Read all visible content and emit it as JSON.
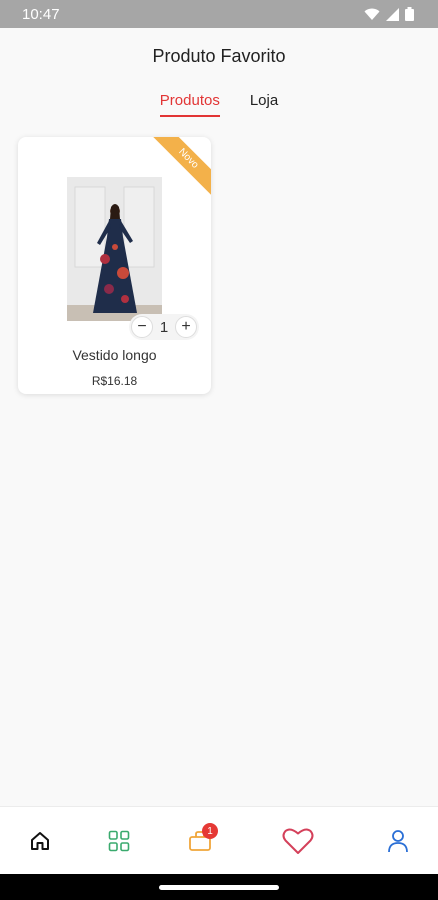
{
  "status_bar": {
    "time": "10:47"
  },
  "header": {
    "title": "Produto Favorito"
  },
  "tabs": [
    {
      "label": "Produtos",
      "active": true
    },
    {
      "label": "Loja",
      "active": false
    }
  ],
  "product": {
    "ribbon": "Novo",
    "name": "Vestido longo",
    "price": "R$16.18",
    "quantity": "1",
    "minus": "−",
    "plus": "+"
  },
  "bottom_nav": {
    "items": [
      {
        "icon": "home-icon"
      },
      {
        "icon": "categories-icon"
      },
      {
        "icon": "bag-icon",
        "badge": "1"
      },
      {
        "icon": "heart-icon"
      },
      {
        "icon": "user-icon"
      }
    ]
  },
  "colors": {
    "accent": "#e23535",
    "ribbon": "#f3b14a",
    "badge": "#e53935",
    "categories": "#3aaa6e",
    "bag": "#f0a63a",
    "heart": "#d4405a",
    "user": "#2a6fd6"
  }
}
